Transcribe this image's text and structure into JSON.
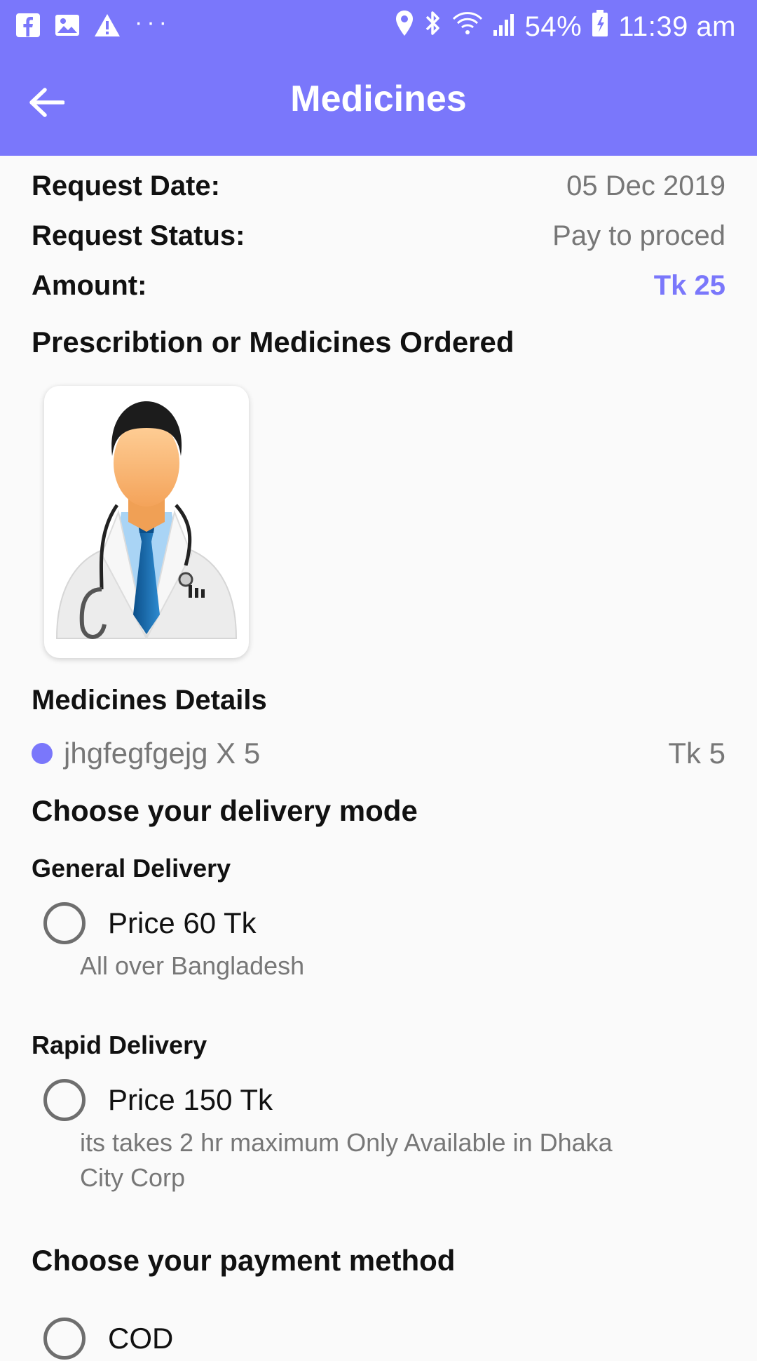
{
  "status_bar": {
    "left_icons": [
      "facebook-icon",
      "gallery-icon",
      "warning-icon"
    ],
    "overflow": "···",
    "battery": "54%",
    "time": "11:39 am"
  },
  "app_bar": {
    "title": "Medicines",
    "color": "#7a77fb"
  },
  "request": {
    "date_label": "Request Date:",
    "date_value": "05 Dec 2019",
    "status_label": "Request Status:",
    "status_value": "Pay to proced",
    "amount_label": "Amount:",
    "amount_value": "Tk 25"
  },
  "prescription": {
    "title": "Prescribtion or Medicines Ordered",
    "image_icon": "doctor-avatar"
  },
  "medicines": {
    "title": "Medicines Details",
    "items": [
      {
        "name": "jhgfegfgejg X 5",
        "price": "Tk 5"
      }
    ]
  },
  "delivery": {
    "title": "Choose your delivery mode",
    "general": {
      "heading": "General Delivery",
      "option": "Price 60 Tk",
      "hint": "All over Bangladesh"
    },
    "rapid": {
      "heading": "Rapid Delivery",
      "option": "Price 150 Tk",
      "hint": "its takes 2 hr maximum Only Available in Dhaka City Corp"
    }
  },
  "payment": {
    "title": "Choose your payment method",
    "options": [
      "COD"
    ]
  }
}
